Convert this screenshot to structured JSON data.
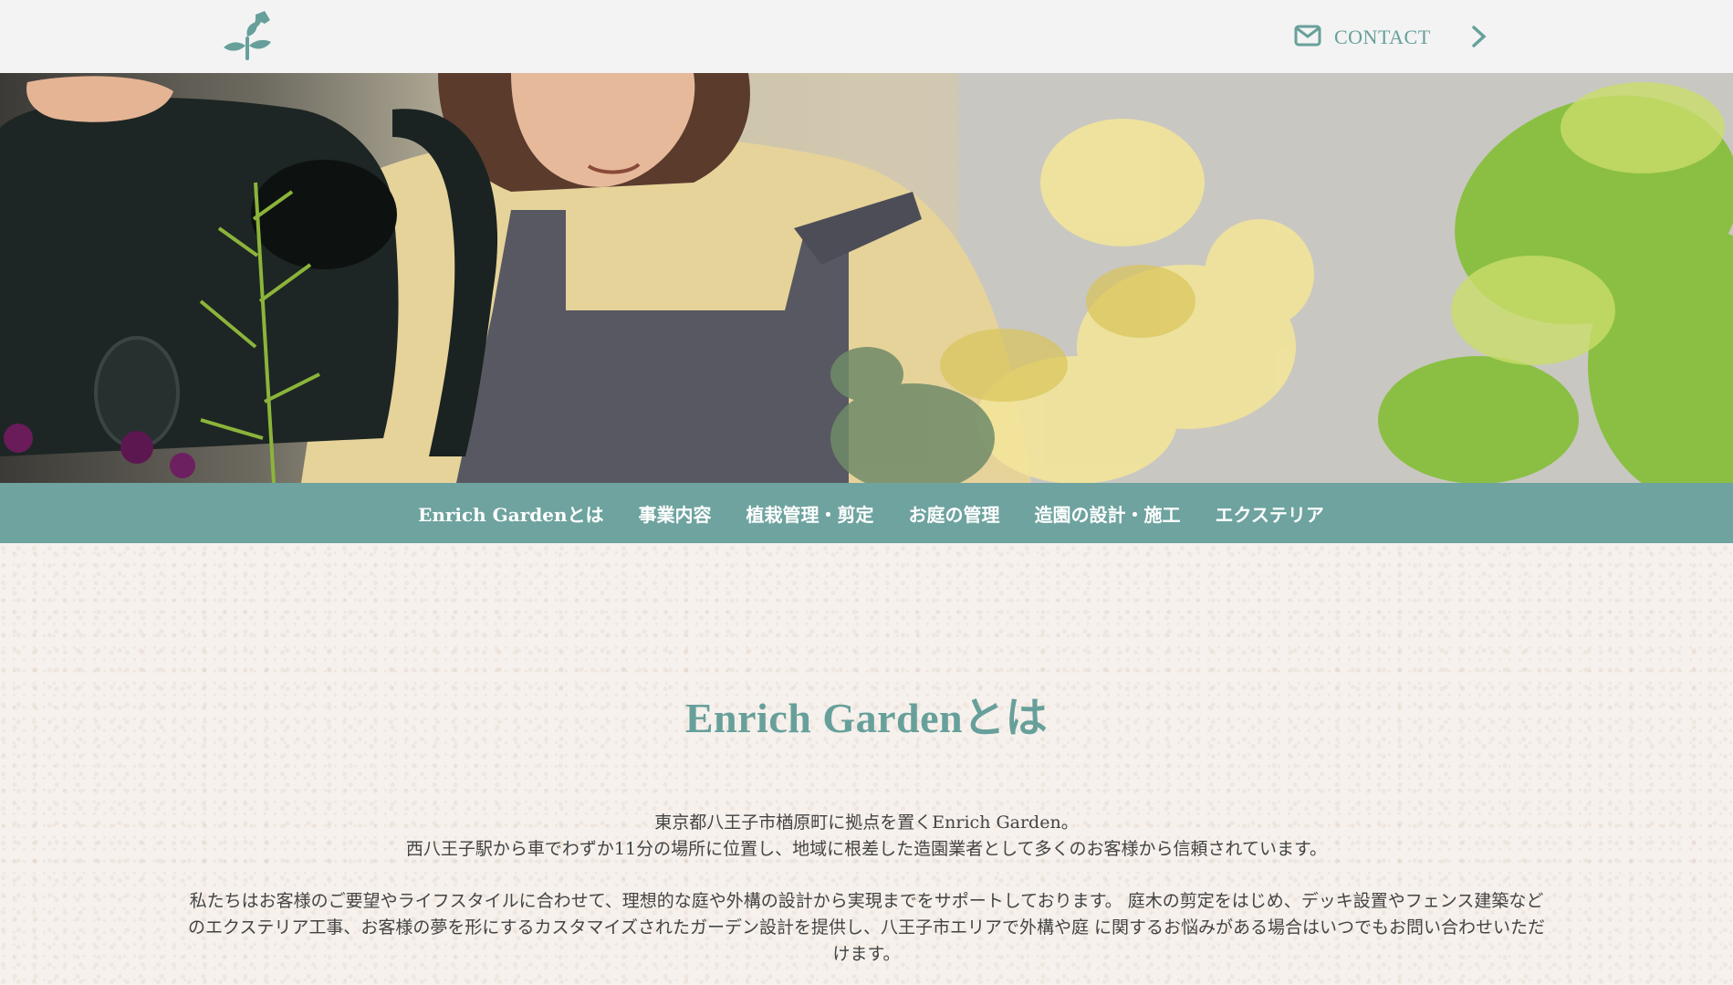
{
  "header": {
    "logo": "watering-can-plant-logo",
    "contact_label": "CONTACT",
    "contact_icon": "mail-icon",
    "next_icon": "chevron-right-icon"
  },
  "hero": {
    "image": "person-watering-plants-photo"
  },
  "nav": {
    "items": [
      {
        "label": "Enrich Gardenとは"
      },
      {
        "label": "事業内容"
      },
      {
        "label": "植栽管理・剪定"
      },
      {
        "label": "お庭の管理"
      },
      {
        "label": "造園の設計・施工"
      },
      {
        "label": "エクステリア"
      }
    ]
  },
  "about": {
    "title": "Enrich Gardenとは",
    "p1_line1": "東京都八王子市楢原町に拠点を置くEnrich Garden。",
    "p1_line2": "西八王子駅から車でわずか11分の場所に位置し、地域に根差した造園業者として多くのお客様から信頼されています。",
    "p2": "私たちはお客様のご要望やライフスタイルに合わせて、理想的な庭や外構の設計から実現までをサポートしております。 庭木の剪定をはじめ、デッキ設置やフェンス建築などのエクステリア工事、お客様の夢を形にするカスタマイズされたガーデン設計を提供し、八王子市エリアで外構や庭 に関するお悩みがある場合はいつでもお問い合わせいただけます。"
  },
  "colors": {
    "accent": "#67a09b",
    "nav_bg": "#6ea39f",
    "header_bg": "#f3f3f3",
    "content_bg": "#f6f1ec"
  }
}
